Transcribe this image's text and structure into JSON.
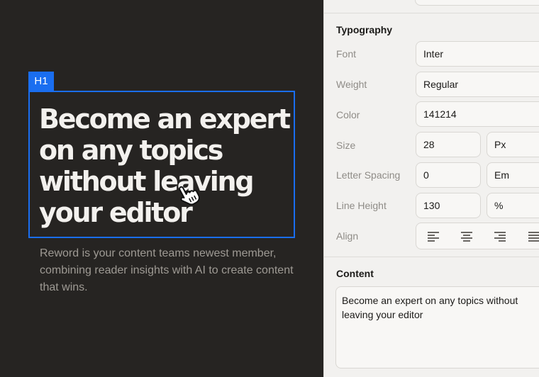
{
  "canvas": {
    "tag": "H1",
    "headline": "Become an expert on any topics without leaving your editor",
    "subtext": "Reword is your content teams newest member, combining reader insights with AI to create content that wins."
  },
  "panel": {
    "typography_title": "Typography",
    "font": {
      "label": "Font",
      "value": "Inter"
    },
    "weight": {
      "label": "Weight",
      "value": "Regular"
    },
    "color": {
      "label": "Color",
      "value": "141214"
    },
    "size": {
      "label": "Size",
      "value": "28",
      "unit": "Px"
    },
    "letter_spacing": {
      "label": "Letter Spacing",
      "value": "0",
      "unit": "Em"
    },
    "line_height": {
      "label": "Line Height",
      "value": "130",
      "unit": "%"
    },
    "align": {
      "label": "Align",
      "options": [
        "left",
        "center",
        "right",
        "justify"
      ]
    },
    "content_title": "Content",
    "content_value": "Become an expert on any topics without leaving your editor"
  },
  "colors": {
    "accent": "#1a6ef0",
    "canvas_bg": "#262422",
    "panel_bg": "#f2f1ef"
  },
  "icons": [
    "hand-pointer-icon",
    "chevron-down-icon",
    "align-left-icon",
    "align-center-icon",
    "align-right-icon",
    "align-justify-icon"
  ]
}
